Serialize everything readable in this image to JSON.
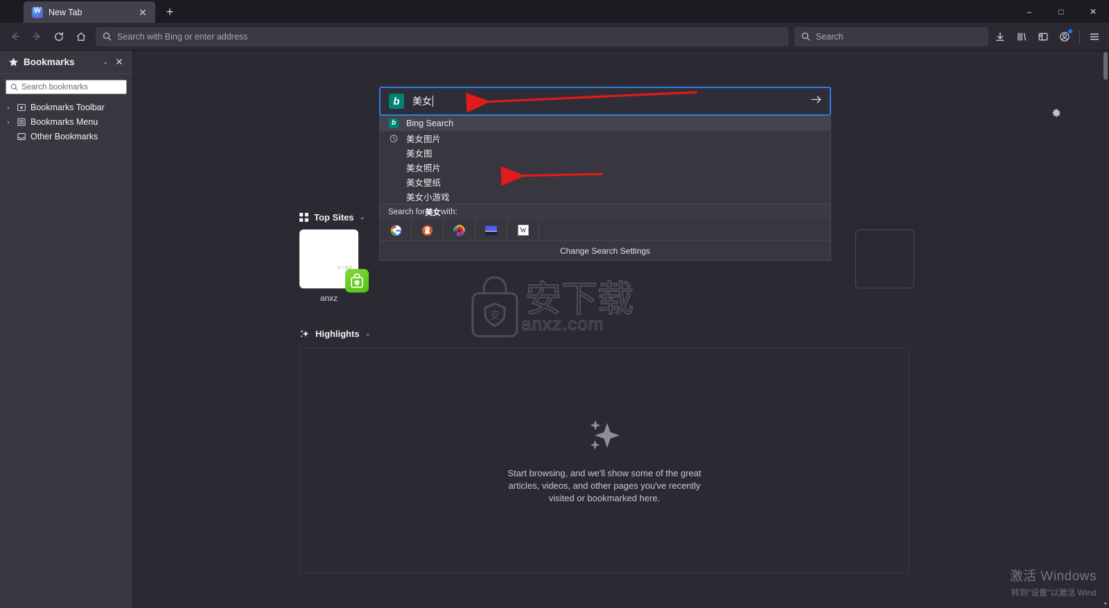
{
  "window": {
    "minimize_label": "–",
    "maximize_label": "□",
    "close_label": "✕"
  },
  "tabstrip": {
    "tab_title": "New Tab",
    "tab_close_label": "✕",
    "newtab_label": "+"
  },
  "toolbar": {
    "back_label": "back-arrow",
    "forward_label": "forward-arrow",
    "reload_label": "reload",
    "home_label": "home",
    "url_placeholder": "Search with Bing or enter address",
    "search_placeholder": "Search",
    "downloads_label": "downloads",
    "library_label": "library",
    "sidebar_label": "sidebar-toggle",
    "account_label": "account",
    "menu_label": "application-menu"
  },
  "sidebar": {
    "title": "Bookmarks",
    "chevron": "⌄",
    "close_label": "✕",
    "search_placeholder": "Search bookmarks",
    "items": [
      {
        "label": "Bookmarks Toolbar",
        "twisty": "›",
        "icon": "bookmarks-toolbar-icon"
      },
      {
        "label": "Bookmarks Menu",
        "twisty": "›",
        "icon": "bookmarks-menu-icon"
      },
      {
        "label": "Other Bookmarks",
        "twisty": "",
        "icon": "other-bookmarks-icon"
      }
    ]
  },
  "newtab": {
    "topsites": {
      "title": "Top Sites",
      "chevron": "⌄",
      "tile_label": "anxz",
      "tile_faint_text": "安下载网"
    },
    "highlights": {
      "title": "Highlights",
      "chevron": "⌄",
      "empty_text": "Start browsing, and we'll show some of the great articles, videos, and other pages you've recently visited or bookmarked here."
    },
    "watermark": {
      "logo_char": "安",
      "brand": "安下载",
      "domain": "anxz.com"
    }
  },
  "search_panel": {
    "query": "美女",
    "engine_name": "Bing Search",
    "engine_logo_char": "b",
    "go_label": "→",
    "suggestions": [
      {
        "text": "美女图片",
        "icon": "history-clock-icon"
      },
      {
        "text": "美女图",
        "icon": ""
      },
      {
        "text": "美女照片",
        "icon": ""
      },
      {
        "text": "美女壁纸",
        "icon": ""
      },
      {
        "text": "美女小游戏",
        "icon": ""
      }
    ],
    "search_with_prefix": "Search for ",
    "search_with_suffix": " with:",
    "engines": [
      {
        "name": "google-icon",
        "glyph": "G"
      },
      {
        "name": "duckduckgo-icon",
        "glyph": ""
      },
      {
        "name": "qwant-icon",
        "glyph": ""
      },
      {
        "name": "amazon-icon",
        "glyph": ""
      },
      {
        "name": "wikipedia-icon",
        "glyph": "W"
      }
    ],
    "settings_label": "Change Search Settings"
  },
  "annotations": {
    "arrow_color": "#e01b1b",
    "arrow_count": 2
  },
  "windows_activation": {
    "line1": "激活 Windows",
    "line2": "转到\"设置\"以激活 Wind"
  }
}
